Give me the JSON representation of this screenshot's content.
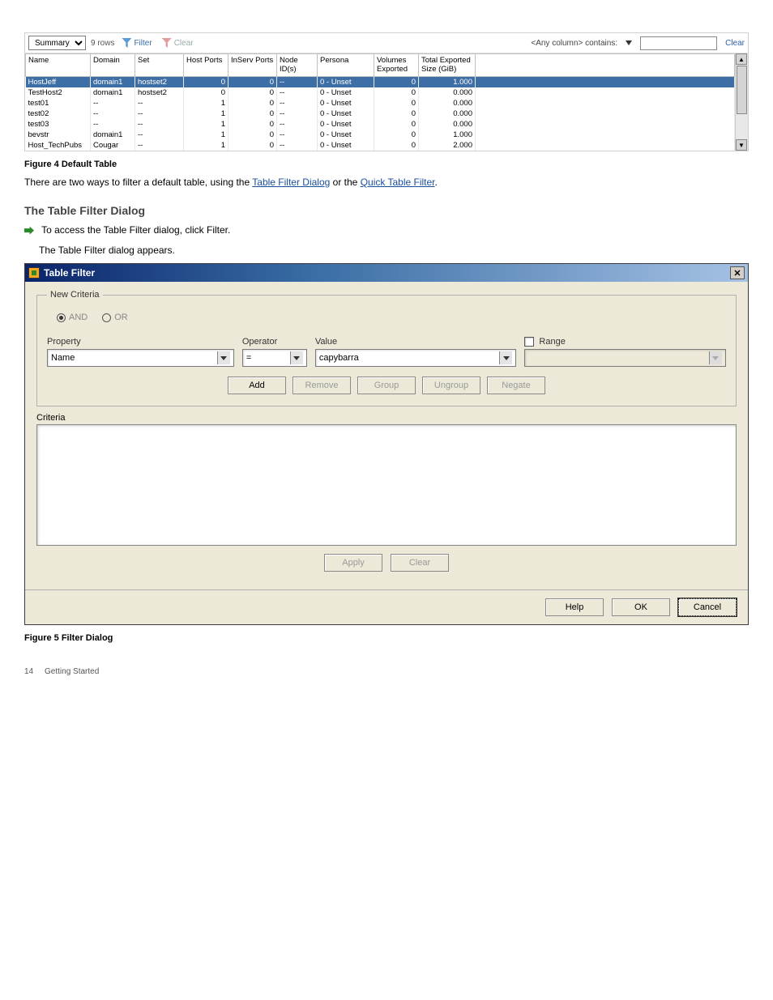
{
  "toolbar": {
    "defaultTable": "Summary",
    "rowCount": "9 rows",
    "filterLabel": "Filter",
    "clearFilterLabel": "Clear",
    "searchLabel": "<Any column> contains:",
    "searchValue": "",
    "clearLink": "Clear"
  },
  "columns": [
    "Name",
    "Domain",
    "Set",
    "Host Ports",
    "InServ Ports",
    "Node ID(s)",
    "Persona",
    "Volumes Exported",
    "Total Exported Size (GiB)"
  ],
  "rows": [
    {
      "name": "HostJeff",
      "domain": "domain1",
      "set": "hostset2",
      "hp": "0",
      "ip": "0",
      "nid": "--",
      "persona": "0 - Unset",
      "vols": "0",
      "size": "1.000",
      "sel": true
    },
    {
      "name": "TestHost2",
      "domain": "domain1",
      "set": "hostset2",
      "hp": "0",
      "ip": "0",
      "nid": "--",
      "persona": "0 - Unset",
      "vols": "0",
      "size": "0.000"
    },
    {
      "name": "test01",
      "domain": "--",
      "set": "--",
      "hp": "1",
      "ip": "0",
      "nid": "--",
      "persona": "0 - Unset",
      "vols": "0",
      "size": "0.000"
    },
    {
      "name": "test02",
      "domain": "--",
      "set": "--",
      "hp": "1",
      "ip": "0",
      "nid": "--",
      "persona": "0 - Unset",
      "vols": "0",
      "size": "0.000"
    },
    {
      "name": "test03",
      "domain": "--",
      "set": "--",
      "hp": "1",
      "ip": "0",
      "nid": "--",
      "persona": "0 - Unset",
      "vols": "0",
      "size": "0.000"
    },
    {
      "name": "bevstr",
      "domain": "domain1",
      "set": "--",
      "hp": "1",
      "ip": "0",
      "nid": "--",
      "persona": "0 - Unset",
      "vols": "0",
      "size": "1.000"
    },
    {
      "name": "Host_TechPubs",
      "domain": "Cougar",
      "set": "--",
      "hp": "1",
      "ip": "0",
      "nid": "--",
      "persona": "0 - Unset",
      "vols": "0",
      "size": "2.000"
    }
  ],
  "caption": "Figure 4 Default Table",
  "bodyText1": "There are two ways to filter a default table, using the ",
  "link1": "Table Filter Dialog",
  "bodyText2": " or the ",
  "link2": "Quick Table Filter",
  "bodyText3": ".",
  "sectionTitle": "The Table Filter Dialog",
  "step1": "To access the Table Filter dialog, click Filter.",
  "step2": "The Table Filter dialog appears.",
  "dialog": {
    "title": "Table Filter",
    "groupLabel": "New Criteria",
    "andLabel": "AND",
    "orLabel": "OR",
    "propertyLabel": "Property",
    "propertyValue": "Name",
    "operatorLabel": "Operator",
    "operatorValue": "=",
    "valueLabel": "Value",
    "valueValue": "capybarra",
    "rangeLabel": "Range",
    "rangeValue": "",
    "addBtn": "Add",
    "removeBtn": "Remove",
    "groupBtn": "Group",
    "ungroupBtn": "Ungroup",
    "negateBtn": "Negate",
    "criteriaLabel": "Criteria",
    "applyBtn": "Apply",
    "clearBtn": "Clear",
    "helpBtn": "Help",
    "okBtn": "OK",
    "cancelBtn": "Cancel"
  },
  "figCaption2": "Figure 5 Filter Dialog",
  "footerLeft": "14",
  "footerRight": "Getting Started"
}
